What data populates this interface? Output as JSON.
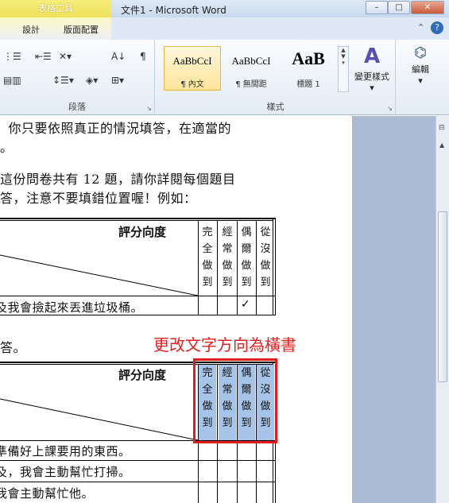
{
  "titlebar": {
    "context_tab_group": "表格工具",
    "document_title": "文件1 - Microsoft Word",
    "minimize": "–",
    "maximize": "□",
    "close": "✕"
  },
  "tabs": {
    "design": "設計",
    "layout": "版面配置",
    "help_icon": "?",
    "collapse_icon": "⌃"
  },
  "ribbon": {
    "paragraph_group": "段落",
    "styles_group": "樣式",
    "styles": [
      {
        "sample": "AaBbCcI",
        "name": "¶ 內文"
      },
      {
        "sample": "AaBbCcI",
        "name": "¶ 無間距"
      },
      {
        "sample": "AaB",
        "name": "標題 1"
      }
    ],
    "change_styles": "變更樣式",
    "edit": "編輯"
  },
  "document": {
    "line1": "，你只要依照真正的情況填答，在適當的",
    "line2": "。",
    "line3": "這份問卷共有 12 題，請你詳閱每個題目",
    "line4": "答，注意不要填錯位置喔！例如：",
    "table1": {
      "header": "評分向度",
      "columns": [
        "完全做到",
        "經常做到",
        "偶爾做到",
        "從沒做到"
      ],
      "row1_text": "及我會撿起來丟進垃圾桶。",
      "check": "✓"
    },
    "line5": "答。",
    "annotation": "更改文字方向為橫書",
    "table2": {
      "header": "評分向度",
      "columns": [
        "完全做到",
        "經常做到",
        "偶爾做到",
        "從沒做到"
      ],
      "rows": [
        "準備好上課要用的東西。",
        "及，我會主動幫忙打掃。",
        "我會主動幫忙他。"
      ]
    }
  },
  "colors": {
    "highlight": "#a5c4e8",
    "annotation_red": "#e02020"
  }
}
